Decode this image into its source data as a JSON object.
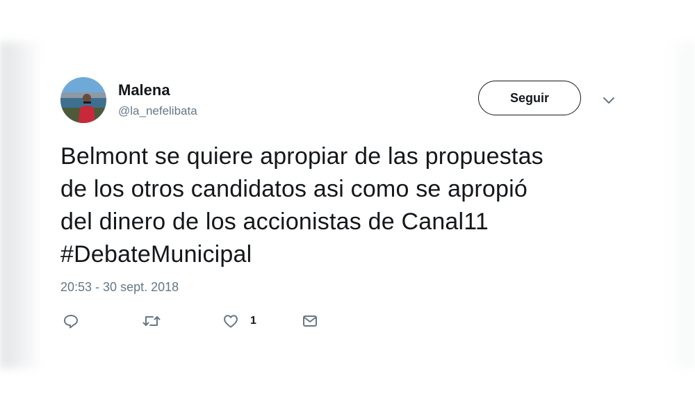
{
  "tweet": {
    "author": {
      "display_name": "Malena",
      "handle": "@la_nefelibata",
      "avatar": "profile-photo"
    },
    "follow_label": "Seguir",
    "menu_icon": "chevron-down-icon",
    "text_lines": [
      "Belmont se quiere apropiar de las propuestas",
      "de los otros candidatos asi como se apropió",
      "del dinero de los accionistas de Canal11",
      "#DebateMunicipal"
    ],
    "timestamp": "20:53 - 30 sept. 2018",
    "actions": {
      "reply": {
        "icon": "reply-icon"
      },
      "retweet": {
        "icon": "retweet-icon"
      },
      "like": {
        "icon": "heart-icon",
        "count": "1"
      },
      "message": {
        "icon": "envelope-icon"
      }
    }
  },
  "colors": {
    "text_primary": "#14171a",
    "text_secondary": "#657786",
    "background": "#ffffff"
  }
}
